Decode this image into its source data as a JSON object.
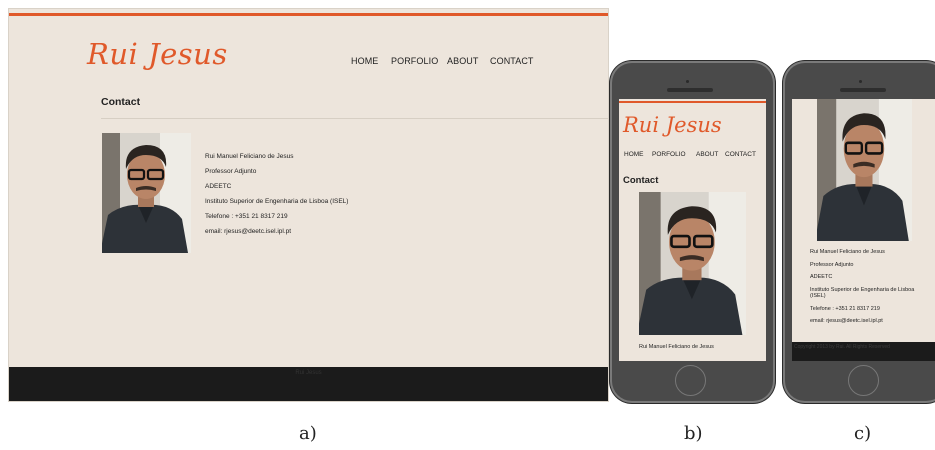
{
  "site": {
    "logo": "Rui Jesus",
    "nav": [
      "HOME",
      "PORFOLIO",
      "ABOUT",
      "CONTACT"
    ],
    "heading": "Contact",
    "contact": {
      "name": "Rui Manuel Feliciano de Jesus",
      "title": "Professor Adjunto",
      "dept": "ADEETC",
      "institute": "Instituto Superior de Engenharia de Lisboa (ISEL)",
      "phone": "Telefone : +351 21 8317 219",
      "email": "email: rjesus@deetc.isel.ipl.pt"
    },
    "footer": "Rui Jesus",
    "phone_footer": "Copyright 2013 by Rui. All Rights Reserved"
  },
  "captions": {
    "a": "a)",
    "b": "b)",
    "c": "c)"
  },
  "colors": {
    "accent": "#e0592a",
    "page_bg": "#ede5dc",
    "footer_bg": "#1b1b1b",
    "phone_body": "#4a4a4a"
  },
  "icons": {
    "photo": "portrait-photo",
    "home": "home-button"
  }
}
